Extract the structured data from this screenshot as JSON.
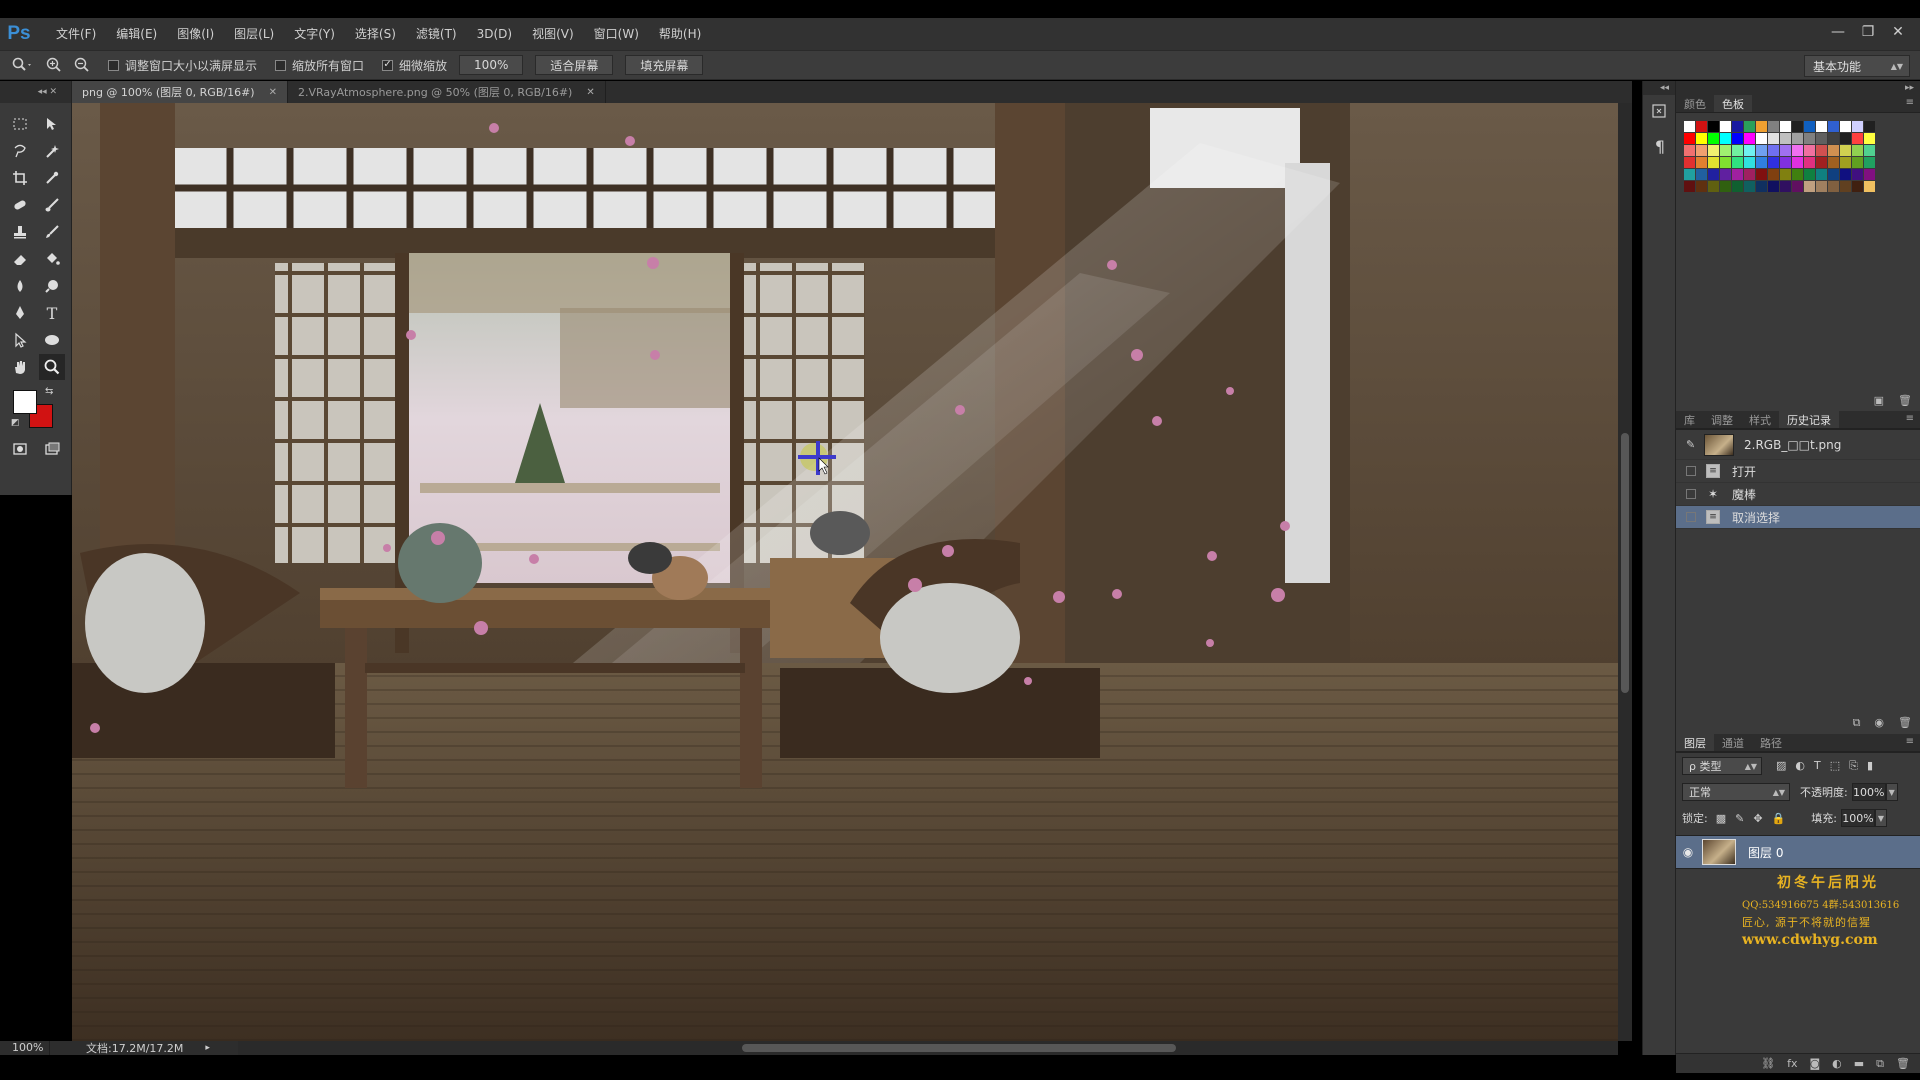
{
  "app": {
    "logo": "Ps"
  },
  "menu": [
    "文件(F)",
    "编辑(E)",
    "图像(I)",
    "图层(L)",
    "文字(Y)",
    "选择(S)",
    "滤镜(T)",
    "3D(D)",
    "视图(V)",
    "窗口(W)",
    "帮助(H)"
  ],
  "window_controls": {
    "minimize": "—",
    "restore": "❐",
    "close": "✕"
  },
  "options": {
    "zoom_tool_icon": "zoom-icon",
    "resize_windows_label": "调整窗口大小以满屏显示",
    "resize_windows_checked": false,
    "zoom_all_label": "缩放所有窗口",
    "zoom_all_checked": false,
    "scrubby_zoom_label": "细微缩放",
    "scrubby_zoom_checked": true,
    "zoom_value": "100%",
    "fit_screen_label": "适合屏幕",
    "fill_screen_label": "填充屏幕",
    "workspace": "基本功能"
  },
  "tabs": [
    {
      "label": "png @ 100% (图层 0, RGB/16#)",
      "active": true
    },
    {
      "label": "2.VRayAtmosphere.png @ 50% (图层 0, RGB/16#)",
      "active": false
    }
  ],
  "toolbox": {
    "collapse": "◂◂  ✕",
    "fg_color": "#ffffff",
    "bg_color": "#d11212"
  },
  "status": {
    "zoom": "100%",
    "doc_info": "文档:17.2M/17.2M",
    "arrow": "▸"
  },
  "swatches_panel": {
    "tabs": [
      "颜色",
      "色板"
    ],
    "active": "色板"
  },
  "history_panel": {
    "tabs": [
      "库",
      "调整",
      "样式",
      "历史记录"
    ],
    "active": "历史记录",
    "snapshot": "2.RGB_□□t.png",
    "items": [
      {
        "label": "打开",
        "selected": false
      },
      {
        "label": "魔棒",
        "selected": false
      },
      {
        "label": "取消选择",
        "selected": true
      }
    ]
  },
  "layers_panel": {
    "tabs": [
      "图层",
      "通道",
      "路径"
    ],
    "active": "图层",
    "kind": "ρ 类型",
    "blend_mode": "正常",
    "opacity_label": "不透明度:",
    "opacity": "100%",
    "lock_label": "锁定:",
    "fill_label": "填充:",
    "fill": "100%",
    "layer_name": "图层 0"
  },
  "watermark": {
    "title": "初冬午后阳光",
    "qq": "QQ:534916675  4群:543013616",
    "slogan": "匠心, 源于不将就的信猩",
    "url": "www.cdwhyg.com"
  },
  "colors": {
    "menubar": "#323232",
    "panel": "#3a3a3a",
    "selection": "#5b6e8a",
    "accent": "#3b8fd6",
    "watermark": "#e8b322"
  }
}
